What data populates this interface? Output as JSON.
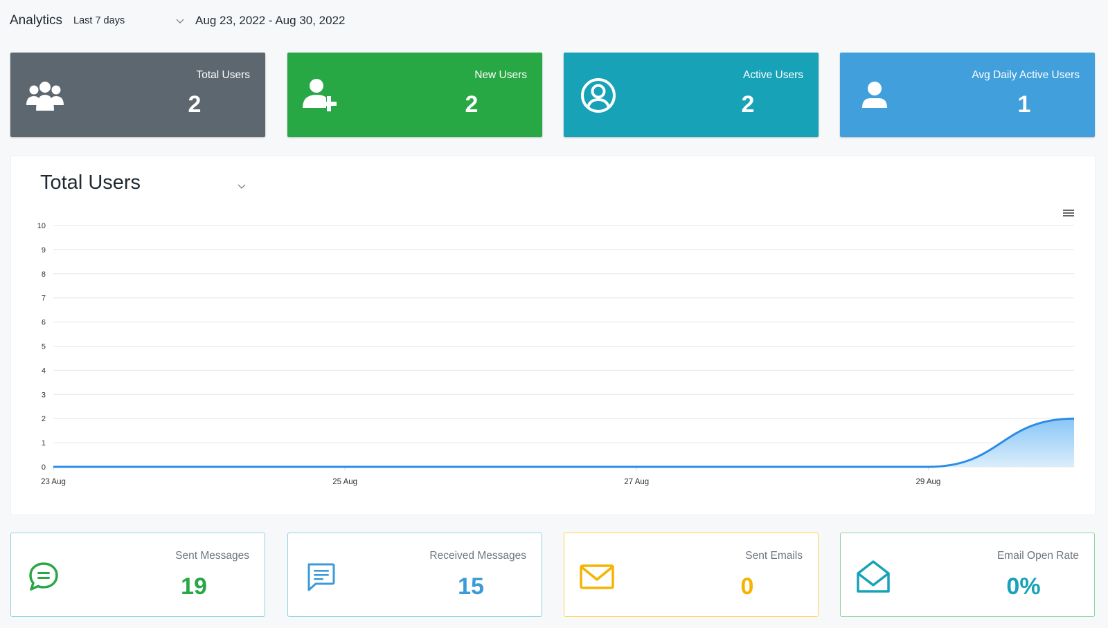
{
  "header": {
    "title": "Analytics",
    "range_select": "Last 7 days",
    "date_range": "Aug 23, 2022 - Aug 30, 2022"
  },
  "stat_cards": [
    {
      "label": "Total Users",
      "value": "2",
      "icon": "users-group-icon",
      "color": "#5c676f"
    },
    {
      "label": "New Users",
      "value": "2",
      "icon": "user-plus-icon",
      "color": "#28a745"
    },
    {
      "label": "Active Users",
      "value": "2",
      "icon": "user-circle-icon",
      "color": "#17a2b8"
    },
    {
      "label": "Avg Daily Active Users",
      "value": "1",
      "icon": "user-icon",
      "color": "#41a0dc"
    }
  ],
  "chart_panel": {
    "title": "Total Users",
    "menu_icon": "hamburger-menu-icon"
  },
  "chart_data": {
    "type": "area",
    "title": "",
    "xlabel": "",
    "ylabel": "",
    "x": [
      "2022-08-23",
      "2022-08-24",
      "2022-08-25",
      "2022-08-26",
      "2022-08-27",
      "2022-08-28",
      "2022-08-29",
      "2022-08-30"
    ],
    "series": [
      {
        "values": [
          0,
          0,
          0,
          0,
          0,
          0,
          0,
          2
        ],
        "color": "#2b8ce8"
      }
    ],
    "x_tick_labels": [
      "23 Aug",
      "25 Aug",
      "27 Aug",
      "29 Aug"
    ],
    "y_ticks": [
      0,
      1,
      2,
      3,
      4,
      5,
      6,
      7,
      8,
      9,
      10
    ],
    "ylim": [
      0,
      10
    ],
    "grid": true,
    "legend": "none"
  },
  "metric_cards": [
    {
      "label": "Sent Messages",
      "value": "19",
      "icon": "chat-bubble-icon",
      "color": "#28a745"
    },
    {
      "label": "Received Messages",
      "value": "15",
      "icon": "message-square-icon",
      "color": "#3c9ad8"
    },
    {
      "label": "Sent Emails",
      "value": "0",
      "icon": "envelope-icon",
      "color": "#f4b400"
    },
    {
      "label": "Email Open Rate",
      "value": "0%",
      "icon": "envelope-open-icon",
      "color": "#17a2b8"
    }
  ]
}
